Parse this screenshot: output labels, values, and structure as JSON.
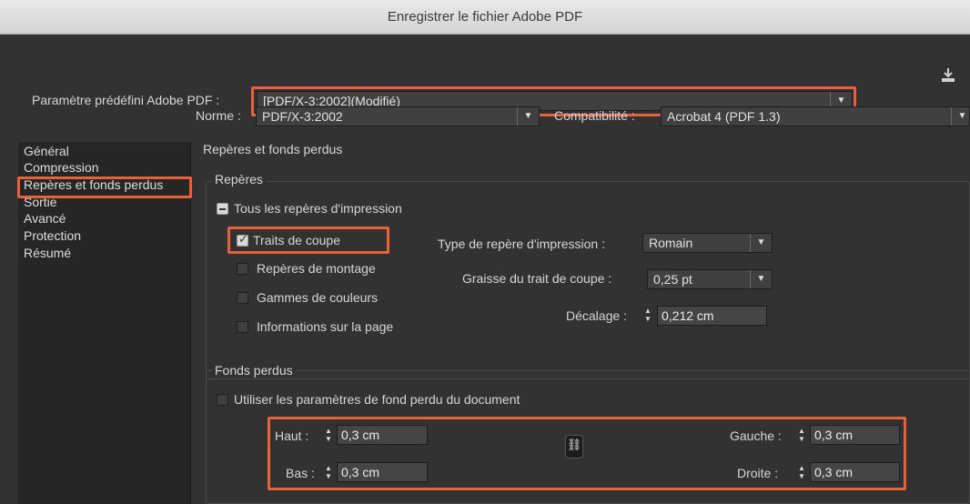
{
  "window": {
    "title": "Enregistrer le fichier Adobe PDF"
  },
  "preset": {
    "label": "Paramètre prédéfini Adobe PDF :",
    "value": "[PDF/X-3:2002](Modifié)"
  },
  "norme": {
    "label": "Norme :",
    "value": "PDF/X-3:2002"
  },
  "compat": {
    "label": "Compatibilité :",
    "value": "Acrobat 4 (PDF 1.3)"
  },
  "sidebar": {
    "items": [
      {
        "label": "Général"
      },
      {
        "label": "Compression"
      },
      {
        "label": "Repères et fonds perdus",
        "selected": true
      },
      {
        "label": "Sortie"
      },
      {
        "label": "Avancé"
      },
      {
        "label": "Protection"
      },
      {
        "label": "Résumé"
      }
    ]
  },
  "panel": {
    "title": "Repères et fonds perdus"
  },
  "marks": {
    "group_title": "Repères",
    "all_marks": "Tous les repères d'impression",
    "crop_marks": "Traits de coupe",
    "registration": "Repères de montage",
    "color_bars": "Gammes de couleurs",
    "page_info": "Informations sur la page",
    "type_label": "Type de repère d'impression :",
    "type_value": "Romain",
    "weight_label": "Graisse du trait de coupe :",
    "weight_value": "0,25 pt",
    "offset_label": "Décalage :",
    "offset_value": "0,212 cm"
  },
  "bleed": {
    "group_title": "Fonds perdus",
    "use_doc": "Utiliser les paramètres de fond perdu du document",
    "top_label": "Haut :",
    "top_value": "0,3 cm",
    "bottom_label": "Bas :",
    "bottom_value": "0,3 cm",
    "left_label": "Gauche :",
    "left_value": "0,3 cm",
    "right_label": "Droite :",
    "right_value": "0,3 cm"
  },
  "colors": {
    "highlight": "#e8603c",
    "background": "#323232",
    "sidebar": "#262626"
  }
}
